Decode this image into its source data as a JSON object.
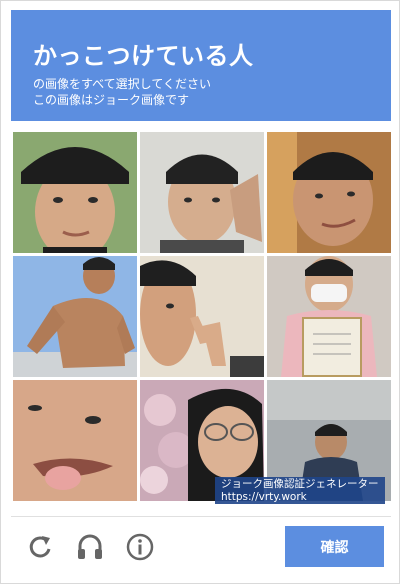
{
  "header": {
    "title": "かっこつけている人",
    "subtitle_line1": "の画像をすべて選択してください",
    "subtitle_line2": "この画像はジョーク画像です"
  },
  "grid": {
    "tiles": [
      {
        "label": "photo-cap-boy"
      },
      {
        "label": "photo-hand-on-head"
      },
      {
        "label": "photo-smirk"
      },
      {
        "label": "photo-shirtless-flex"
      },
      {
        "label": "photo-peace-sign"
      },
      {
        "label": "photo-mask-certificate"
      },
      {
        "label": "photo-tongue-out"
      },
      {
        "label": "photo-glasses-cherry-blossom"
      },
      {
        "label": "photo-small-figure"
      }
    ],
    "watermark_line1": "ジョーク画像認証ジェネレーター",
    "watermark_line2": "https://vrty.work"
  },
  "footer": {
    "icons": [
      "reload-icon",
      "headphones-icon",
      "info-icon"
    ],
    "verify_label": "確認"
  },
  "colors": {
    "accent": "#5c8ee0",
    "icon_gray": "#666666"
  }
}
